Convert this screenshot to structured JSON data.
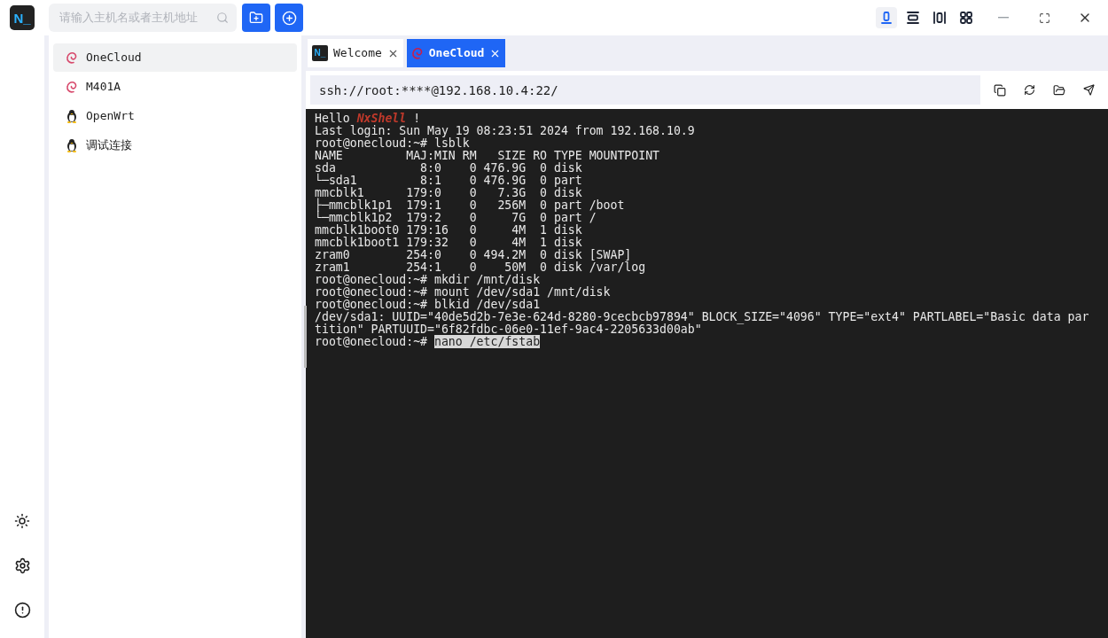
{
  "app": {
    "logo": "N_"
  },
  "search": {
    "placeholder": "请输入主机名或者主机地址"
  },
  "layout_buttons": [
    {
      "kind": "single",
      "selected": true
    },
    {
      "kind": "rows",
      "selected": false
    },
    {
      "kind": "columns",
      "selected": false
    },
    {
      "kind": "grid",
      "selected": false
    }
  ],
  "hosts": [
    {
      "name": "OneCloud",
      "kind": "debian",
      "selected": true
    },
    {
      "name": "M401A",
      "kind": "debian",
      "selected": false
    },
    {
      "name": "OpenWrt",
      "kind": "linux",
      "selected": false
    },
    {
      "name": "调试连接",
      "kind": "linux",
      "selected": false
    }
  ],
  "tabs": [
    {
      "label": "Welcome",
      "icon": "N_",
      "kind": "app",
      "selected": false
    },
    {
      "label": "OneCloud",
      "kind": "debian",
      "selected": true
    }
  ],
  "address": {
    "value": "ssh://root:****@192.168.10.4:22/"
  },
  "terminal": {
    "lines": [
      {
        "kind": "greeting",
        "text": "Hello ",
        "highlight": "NxShell",
        "suffix": " !"
      },
      {
        "kind": "output",
        "text": "Last login: Sun May 19 08:23:51 2024 from 192.168.10.9"
      },
      {
        "kind": "prompt",
        "prompt": "root@onecloud:~# ",
        "command": "lsblk",
        "selected": false
      },
      {
        "kind": "output",
        "text": "NAME         MAJ:MIN RM   SIZE RO TYPE MOUNTPOINT"
      },
      {
        "kind": "output",
        "text": "sda            8:0    0 476.9G  0 disk"
      },
      {
        "kind": "output",
        "text": "└─sda1         8:1    0 476.9G  0 part"
      },
      {
        "kind": "output",
        "text": "mmcblk1      179:0    0   7.3G  0 disk"
      },
      {
        "kind": "output",
        "text": "├─mmcblk1p1  179:1    0   256M  0 part /boot"
      },
      {
        "kind": "output",
        "text": "└─mmcblk1p2  179:2    0     7G  0 part /"
      },
      {
        "kind": "output",
        "text": "mmcblk1boot0 179:16   0     4M  1 disk"
      },
      {
        "kind": "output",
        "text": "mmcblk1boot1 179:32   0     4M  1 disk"
      },
      {
        "kind": "output",
        "text": "zram0        254:0    0 494.2M  0 disk [SWAP]"
      },
      {
        "kind": "output",
        "text": "zram1        254:1    0    50M  0 disk /var/log"
      },
      {
        "kind": "prompt",
        "prompt": "root@onecloud:~# ",
        "command": "mkdir /mnt/disk",
        "selected": false
      },
      {
        "kind": "prompt",
        "prompt": "root@onecloud:~# ",
        "command": "mount /dev/sda1 /mnt/disk",
        "selected": false
      },
      {
        "kind": "prompt",
        "prompt": "root@onecloud:~# ",
        "command": "blkid /dev/sda1",
        "selected": false
      },
      {
        "kind": "output",
        "text": "/dev/sda1: UUID=\"40de5d2b-7e3e-624d-8280-9cecbcb97894\" BLOCK_SIZE=\"4096\" TYPE=\"ext4\" PARTLABEL=\"Basic data par"
      },
      {
        "kind": "output",
        "text": "tition\" PARTUUID=\"6f82fdbc-06e0-11ef-9ac4-2205633d00ab\""
      },
      {
        "kind": "prompt",
        "prompt": "root@onecloud:~# ",
        "command": "nano /etc/fstab",
        "selected": true
      }
    ]
  }
}
